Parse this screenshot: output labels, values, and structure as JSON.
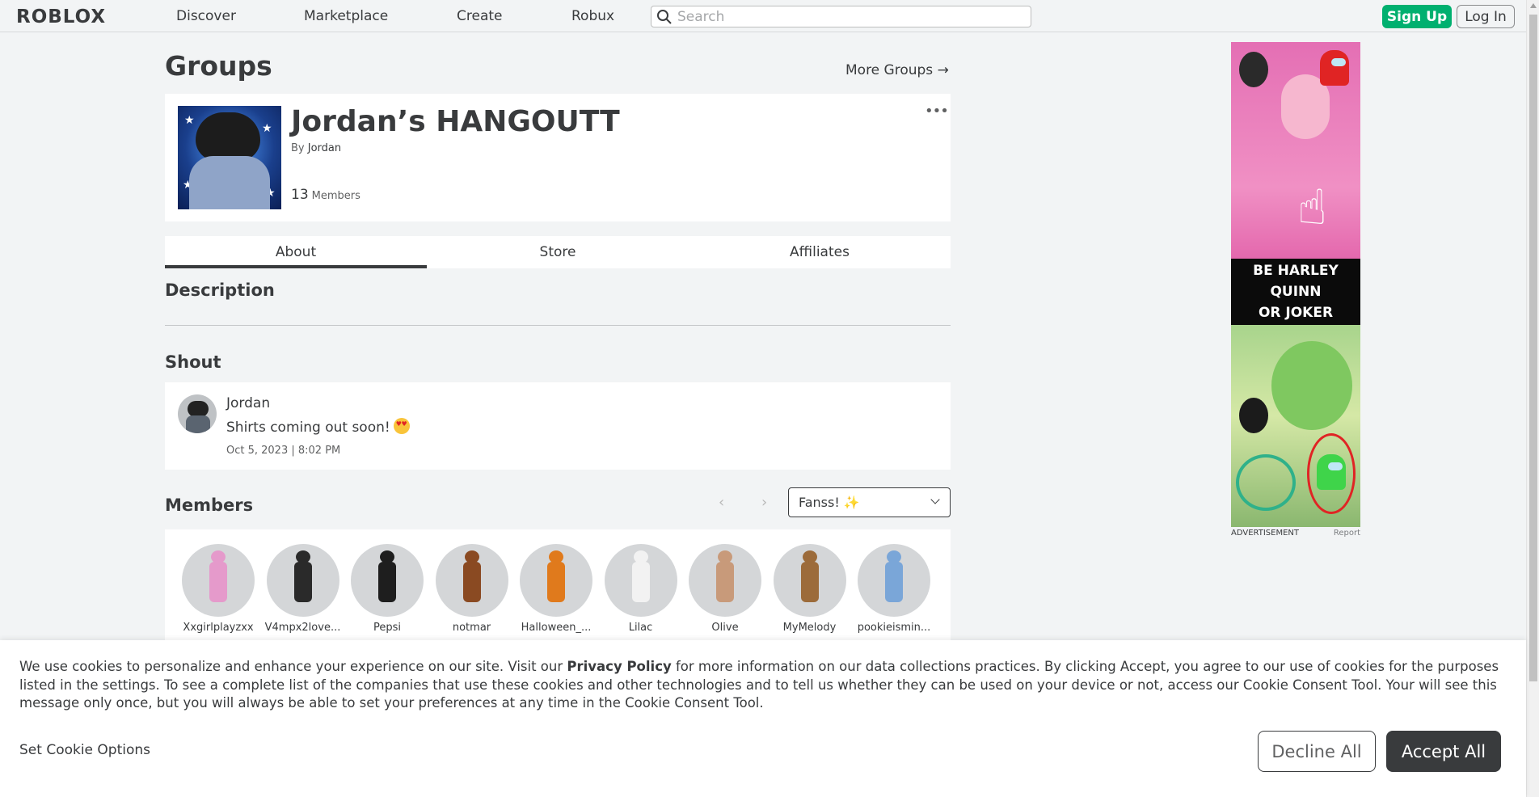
{
  "header": {
    "logo": "ROBLOX",
    "nav": [
      "Discover",
      "Marketplace",
      "Create",
      "Robux"
    ],
    "search_placeholder": "Search",
    "signup": "Sign Up",
    "login": "Log In"
  },
  "page": {
    "title": "Groups",
    "more_groups": "More Groups →"
  },
  "group": {
    "name": "Jordan’s HANGOUTT",
    "by_label": "By",
    "owner": "Jordan",
    "member_count": "13",
    "members_label": "Members"
  },
  "tabs": [
    "About",
    "Store",
    "Affiliates"
  ],
  "sections": {
    "description": "Description",
    "shout": "Shout",
    "members": "Members"
  },
  "shout": {
    "user": "Jordan",
    "text": "Shirts coming out soon!",
    "date": "Oct 5, 2023 | 8:02 PM"
  },
  "role_select": {
    "selected": "Fanss! ✨"
  },
  "members": [
    {
      "name": "Xxgirlplayzxx",
      "color": "#e59acb"
    },
    {
      "name": "V4mpx2love...",
      "color": "#2a2a2a"
    },
    {
      "name": "Pepsi",
      "color": "#1e1e1e"
    },
    {
      "name": "notmar",
      "color": "#8a4a22"
    },
    {
      "name": "Halloween_...",
      "color": "#e07a1c"
    },
    {
      "name": "Lilac",
      "color": "#f2f2f2"
    },
    {
      "name": "Olive",
      "color": "#c89a7a"
    },
    {
      "name": "MyMelody",
      "color": "#9c6b3a"
    },
    {
      "name": "pookieismin...",
      "color": "#7aa6d8"
    }
  ],
  "ad": {
    "band_lines": [
      "BE HARLEY",
      "QUINN",
      "OR JOKER"
    ],
    "caption": "ADVERTISEMENT",
    "report": "Report"
  },
  "cookie": {
    "text_1": "We use cookies to personalize and enhance your experience on our site. Visit our",
    "privacy": "Privacy Policy",
    "text_2": "for more information on our data collections practices. By clicking Accept, you agree to our use of cookies for the purposes listed in the settings. To see a complete list of the companies that use these cookies and other technologies and to tell us whether they can be used on your device or not, access our Cookie Consent Tool. Your will see this message only once, but you will always be able to set your preferences at any time in the Cookie Consent Tool.",
    "set_options": "Set Cookie Options",
    "decline": "Decline All",
    "accept": "Accept All"
  }
}
